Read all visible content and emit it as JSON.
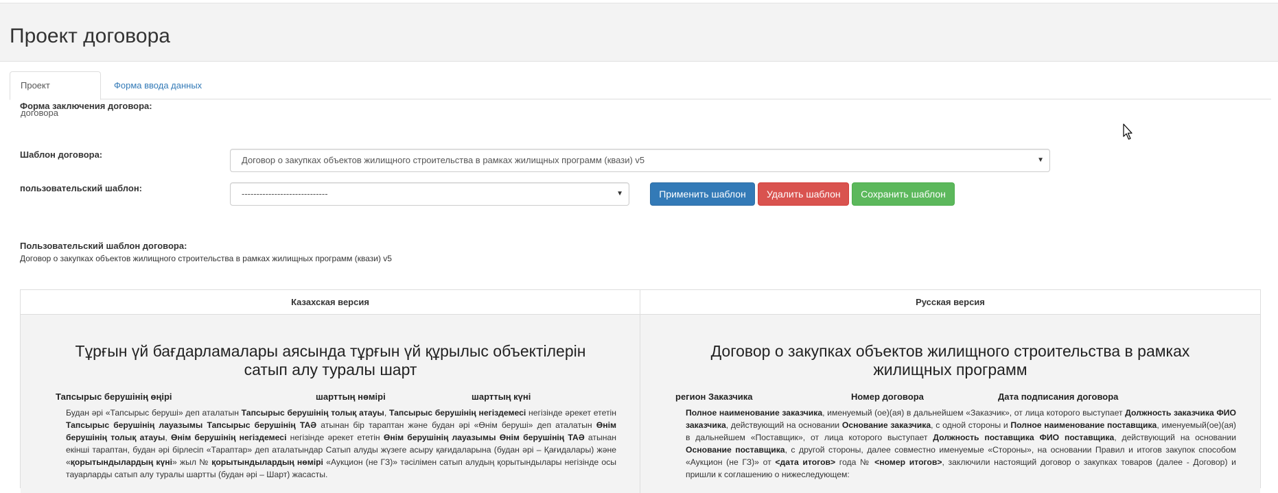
{
  "page_title": "Проект договора",
  "tabs": [
    {
      "label": "Проект договора",
      "active": true
    },
    {
      "label": "Форма ввода данных",
      "active": false
    }
  ],
  "form": {
    "conclusion_label": "Форма заключения договора:",
    "template_label": "Шаблон договора:",
    "template_value": "Договор о закупках объектов жилищного строительства в рамках жилищных программ (квази) v5",
    "user_template_label": "пользовательский шаблон:",
    "user_template_value": "-----------------------------",
    "apply_button": "Применить шаблон",
    "delete_button": "Удалить шаблон",
    "save_button": "Сохранить шаблон",
    "user_contract_template_label": "Пользовательский шаблон договора:",
    "user_contract_template_value": "Договор о закупках объектов жилищного строительства в рамках жилищных программ (квази) v5"
  },
  "table": {
    "kz_header": "Казахская версия",
    "ru_header": "Русская версия",
    "kz": {
      "title": "Тұрғын үй бағдарламалары аясында тұрғын үй құрылыс объектілерін сатып алу туралы шарт",
      "meta_region": "Тапсырыс берушінің өңірі",
      "meta_number": "шарттың нөмірі",
      "meta_date": "шарттың күні",
      "p1_a": "Будан әрі «Тапсырыс беруші» деп аталатын ",
      "p1_b": "Тапсырыс берушінің толық атауы",
      "p1_c": ", ",
      "p1_d": "Тапсырыс берушінің негіздемесі",
      "p1_e": " негізінде әрекет ететін ",
      "p1_f": "Тапсырыс берушінің лауазымы Тапсырыс берушінің ТАӘ",
      "p1_g": " атынан бір тараптан және будан әрі «Өнім беруші» деп аталатын ",
      "p1_h": "Өнім берушінің толық атауы",
      "p1_i": ", ",
      "p1_j": "Өнім берушінің негіздемесі",
      "p1_k": " негізінде әрекет ететін ",
      "p1_l": "Өнім берушінің лауазымы Өнім берушінің ТАӘ",
      "p1_m": " атынан екінші тараптан, будан әрі бірлесіп «Тараптар» деп аталатындар Сатып алуды жүзеге асыру қағидаларына (будан әрі – Қағидалары) және «",
      "p1_n": "қорытындылардың күні",
      "p1_o": "» жыл № ",
      "p1_p": "қорытындылардың нөмірі",
      "p1_q": " «Аукцион (не ГЗ)» тәсілімен сатып алудың қорытындылары негізінде осы тауарларды сатып алу туралы шартты (будан әрі – Шарт) жасасты."
    },
    "ru": {
      "title": "Договор о закупках объектов жилищного строительства в рамках жилищных программ",
      "meta_region": "регион Заказчика",
      "meta_number": "Номер договора",
      "meta_date": "Дата подписания договора",
      "p1_a": "Полное наименование заказчика",
      "p1_b": ", именуемый (ое)(ая) в дальнейшем «Заказчик», от лица которого выступает ",
      "p1_c": "Должность заказчика ФИО заказчика",
      "p1_d": ", действующий на основании ",
      "p1_e": "Основание заказчика",
      "p1_f": ", с одной стороны и ",
      "p1_g": "Полное наименование поставщика",
      "p1_h": ", именуемый(ое)(ая) в дальнейшем «Поставщик», от лица которого выступает ",
      "p1_i": "Должность поставщика ФИО поставщика",
      "p1_j": ", действующий на основании ",
      "p1_k": "Основание поставщика",
      "p1_l": ", с другой стороны, далее совместно именуемые «Стороны», на основании Правил и итогов закупок способом «Аукцион (не ГЗ)» от ",
      "p1_m": "<дата итогов>",
      "p1_n": " года № ",
      "p1_o": "<номер итогов>",
      "p1_p": ", заключили настоящий договор о закупках товаров (далее - Договор) и пришли к соглашению о нижеследующем:"
    }
  },
  "colors": {
    "primary": "#337ab7",
    "danger": "#d9534f",
    "success": "#5cb85c",
    "header_bg": "#f3f3f3"
  },
  "icons": {
    "select_caret": "caret-down-icon",
    "cursor": "mouse-cursor-icon"
  }
}
